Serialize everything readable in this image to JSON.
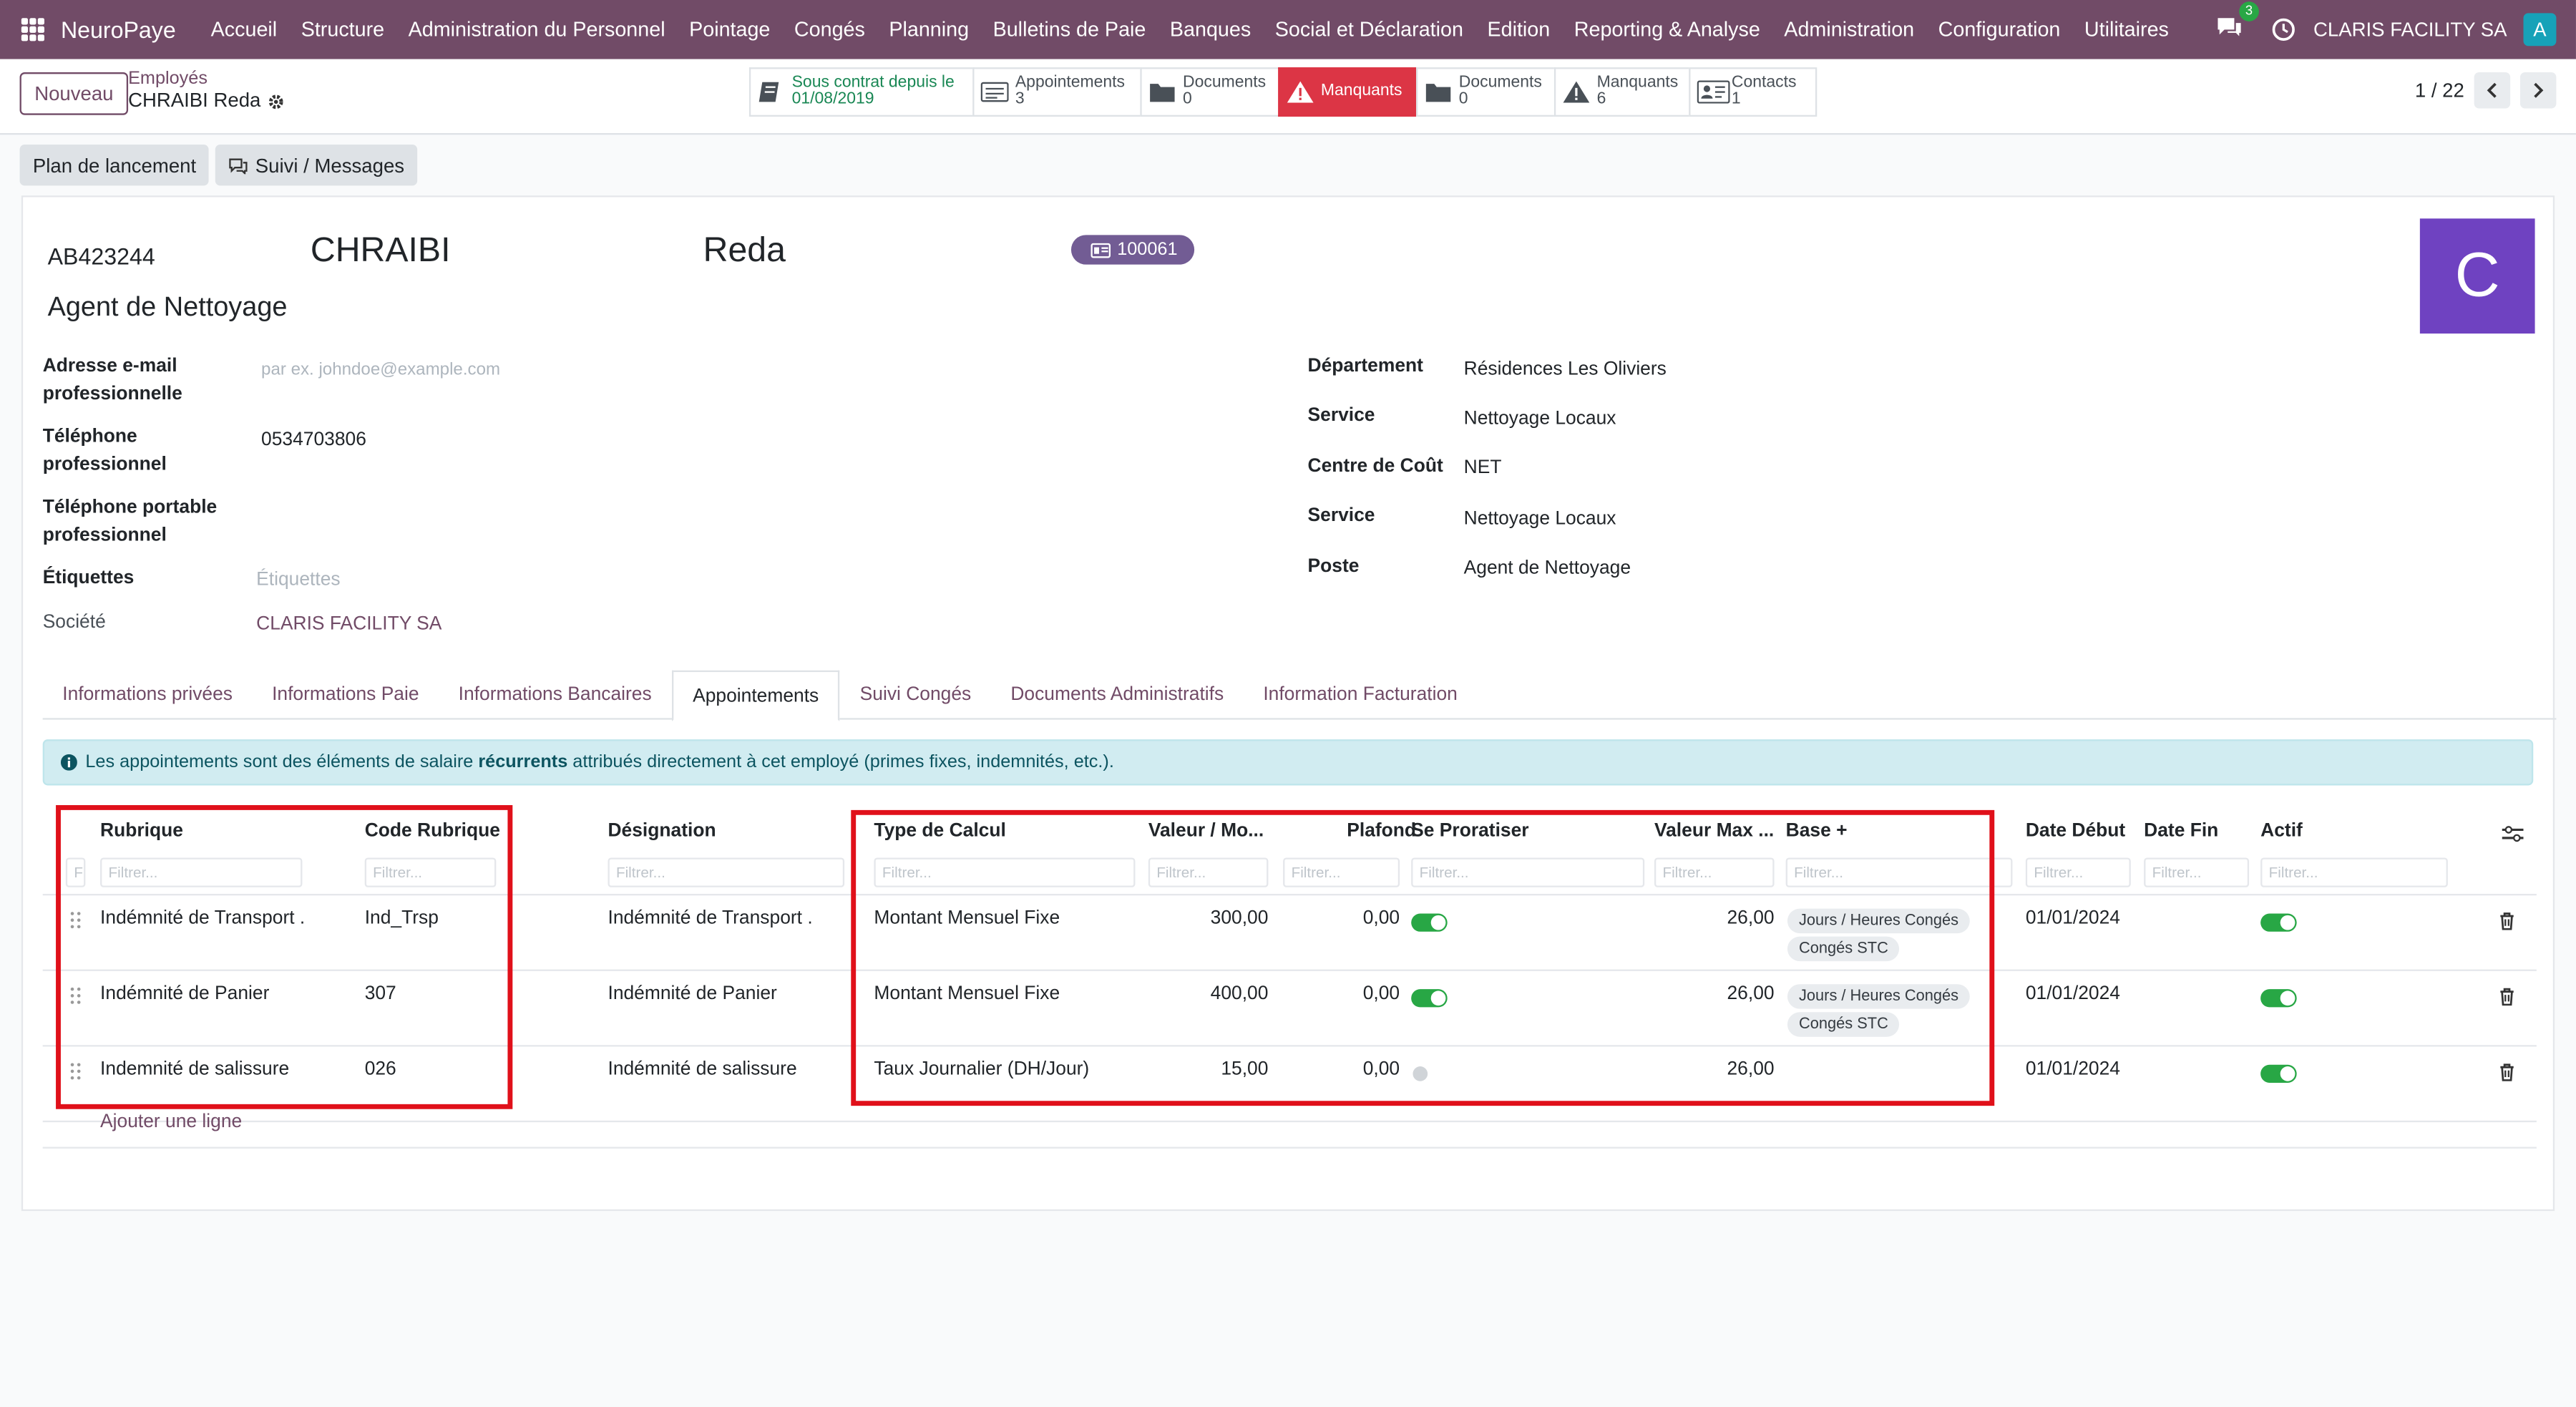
{
  "nav": {
    "brand": "NeuroPaye",
    "menu": [
      "Accueil",
      "Structure",
      "Administration du Personnel",
      "Pointage",
      "Congés",
      "Planning",
      "Bulletins de Paie",
      "Banques",
      "Social et Déclaration",
      "Edition",
      "Reporting & Analyse",
      "Administration",
      "Configuration",
      "Utilitaires"
    ],
    "chat_count": "3",
    "company": "CLARIS FACILITY SA",
    "user_initial": "A"
  },
  "control": {
    "new_button": "Nouveau",
    "breadcrumb_parent": "Employés",
    "breadcrumb_current": "CHRAIBI Reda",
    "stats": [
      {
        "label": "Sous contrat depuis le",
        "value": "01/08/2019",
        "icon": "contract-icon"
      },
      {
        "label": "Appointements",
        "value": "3",
        "icon": "list-icon"
      },
      {
        "label": "Documents",
        "value": "0",
        "icon": "folder-icon"
      },
      {
        "label": "Manquants",
        "value": "",
        "icon": "warning-icon"
      },
      {
        "label": "Documents",
        "value": "0",
        "icon": "folder-icon"
      },
      {
        "label": "Manquants",
        "value": "6",
        "icon": "warning-icon"
      },
      {
        "label": "Contacts",
        "value": "1",
        "icon": "contact-card-icon"
      }
    ],
    "pager": "1 / 22"
  },
  "actions": {
    "launch_plan": "Plan de lancement",
    "follow": "Suivi / Messages"
  },
  "employee": {
    "matricule": "AB423244",
    "last_name": "CHRAIBI",
    "first_name": "Reda",
    "badge": "100061",
    "job_title": "Agent de Nettoyage",
    "avatar_letter": "C",
    "email_label": "Adresse e-mail professionnelle",
    "email_placeholder": "par ex. johndoe@example.com",
    "phone_label": "Téléphone professionnel",
    "phone": "0534703806",
    "mobile_label": "Téléphone portable professionnel",
    "tags_label": "Étiquettes",
    "tags_placeholder": "Étiquettes",
    "company_label": "Société",
    "company": "CLARIS FACILITY SA",
    "dept_label": "Département",
    "dept": "Résidences Les Oliviers",
    "service_label": "Service",
    "service": "Nettoyage Locaux",
    "cost_label": "Centre de Coût",
    "cost": "NET",
    "service2_label": "Service",
    "service2": "Nettoyage Locaux",
    "post_label": "Poste",
    "post": "Agent de Nettoyage"
  },
  "tabs": [
    "Informations privées",
    "Informations Paie",
    "Informations Bancaires",
    "Appointements",
    "Suivi Congés",
    "Documents Administratifs",
    "Information Facturation"
  ],
  "alert": {
    "pre": "Les appointements sont des éléments de salaire ",
    "bold": "récurrents",
    "post": " attribués directement à cet employé (primes fixes, indemnités, etc.)."
  },
  "table": {
    "headers": [
      "Rubrique",
      "Code Rubrique",
      "Désignation",
      "Type de Calcul",
      "Valeur / Mo...",
      "Plafond",
      "Se Proratiser",
      "Valeur Max ...",
      "Base +",
      "Date Début",
      "Date Fin",
      "Actif"
    ],
    "filter_placeholder": "Filtrer...",
    "filter_first": "F",
    "rows": [
      {
        "rubrique": "Indémnité de Transport .",
        "code": "Ind_Trsp",
        "designation": "Indémnité de Transport .",
        "type": "Montant Mensuel Fixe",
        "valeur": "300,00",
        "plafond": "0,00",
        "prorata": true,
        "max": "26,00",
        "tags": [
          "Jours / Heures Congés",
          "Congés STC"
        ],
        "debut": "01/01/2024",
        "fin": "",
        "actif": true
      },
      {
        "rubrique": "Indémnité de Panier",
        "code": "307",
        "designation": "Indémnité de Panier",
        "type": "Montant Mensuel Fixe",
        "valeur": "400,00",
        "plafond": "0,00",
        "prorata": true,
        "max": "26,00",
        "tags": [
          "Jours / Heures Congés",
          "Congés STC"
        ],
        "debut": "01/01/2024",
        "fin": "",
        "actif": true
      },
      {
        "rubrique": "Indemnité de salissure",
        "code": "026",
        "designation": "Indémnité de salissure",
        "type": "Taux Journalier (DH/Jour)",
        "valeur": "15,00",
        "plafond": "0,00",
        "prorata": false,
        "max": "26,00",
        "tags": [],
        "debut": "01/01/2024",
        "fin": "",
        "actif": true
      }
    ],
    "add_line": "Ajouter une ligne"
  }
}
